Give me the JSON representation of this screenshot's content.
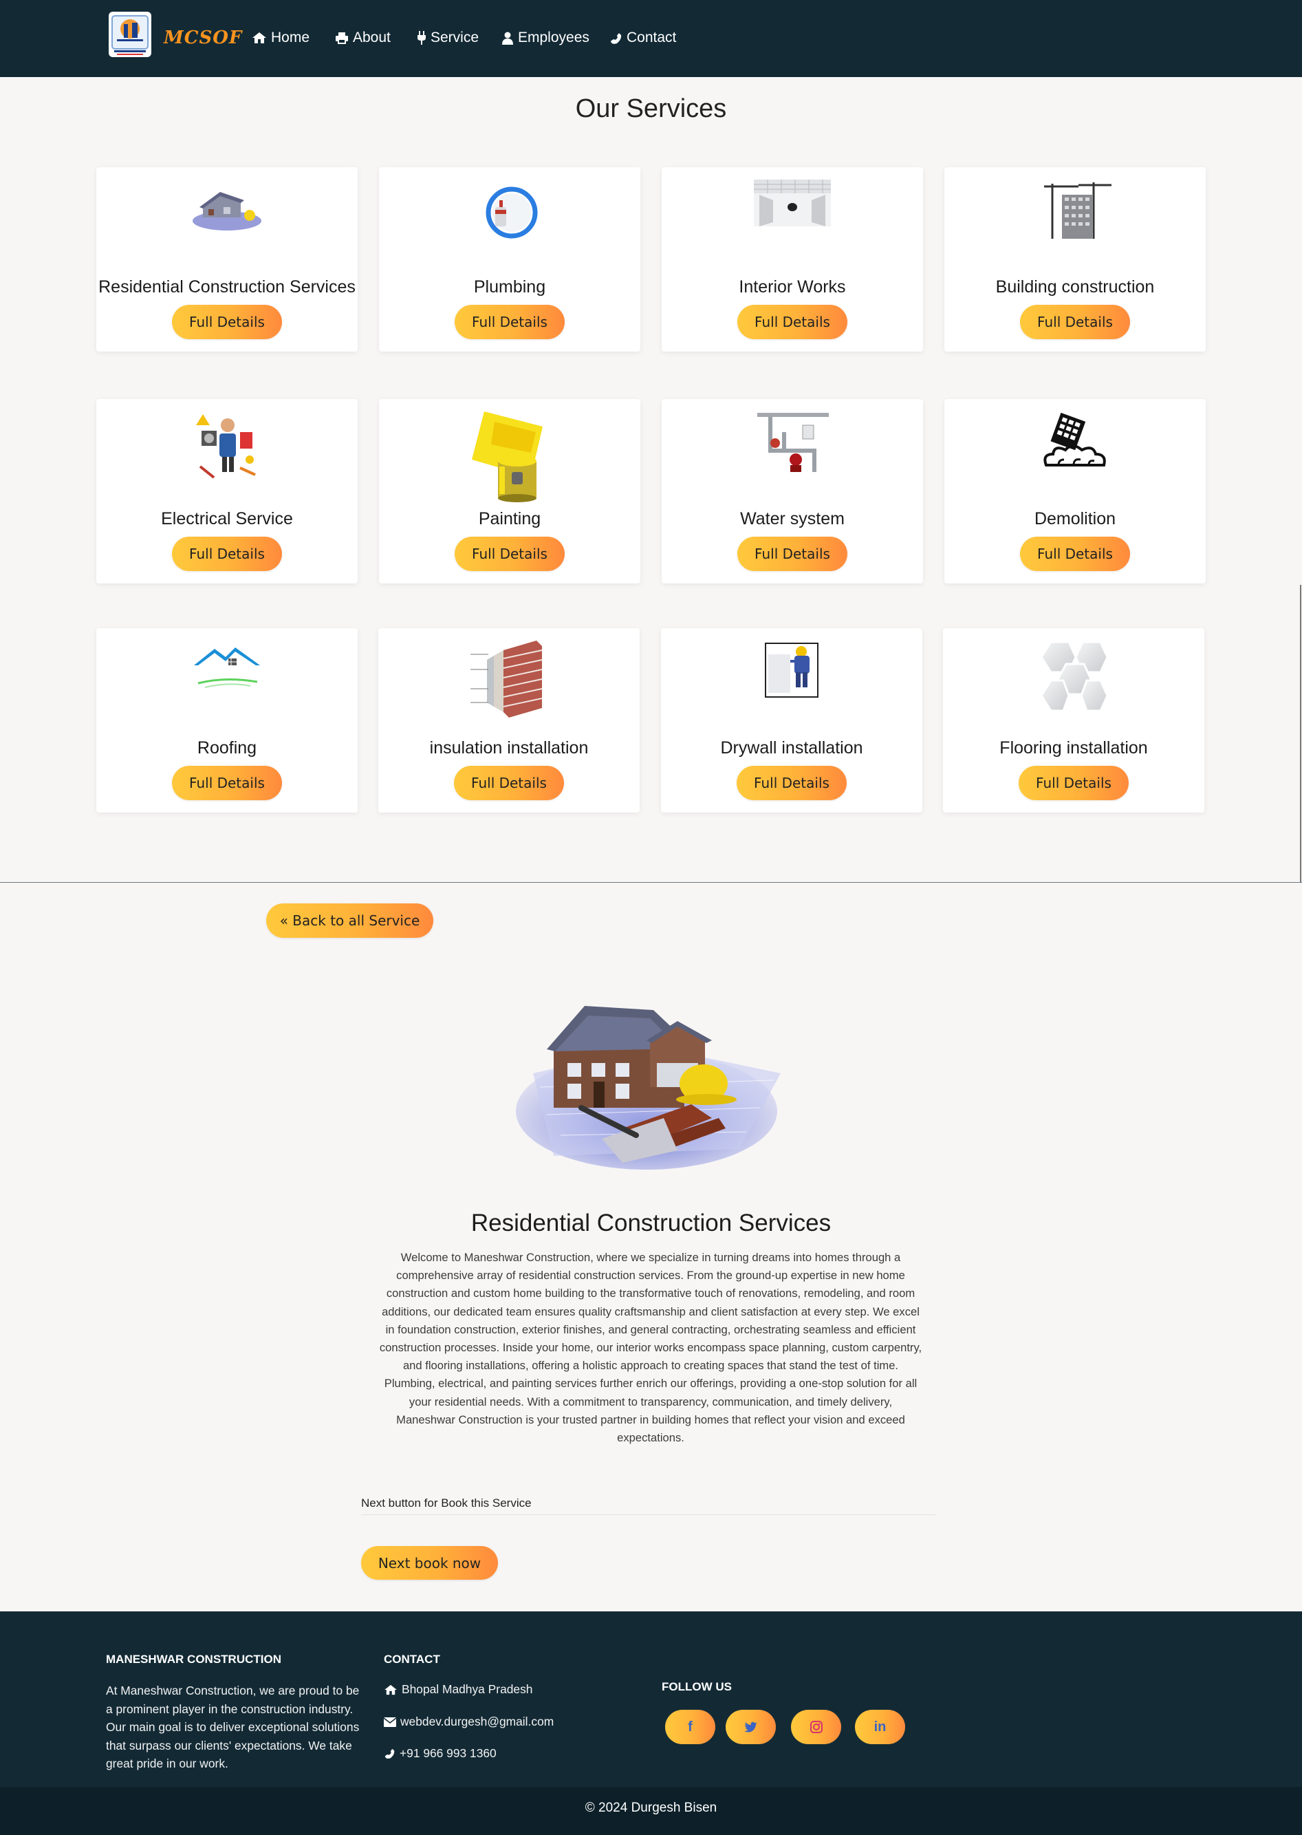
{
  "nav": {
    "brand": "MCSOF",
    "items": [
      "Home",
      "About",
      "Service",
      "Employees",
      "Contact"
    ]
  },
  "services": {
    "heading": "Our Services",
    "cards": [
      {
        "title": "Residential Construction Services",
        "button": "Full Details",
        "image": "house-blueprint"
      },
      {
        "title": "Plumbing",
        "button": "Full Details",
        "image": "pipe-faucet"
      },
      {
        "title": "Interior Works",
        "button": "Full Details",
        "image": "room-interior"
      },
      {
        "title": "Building construction",
        "button": "Full Details",
        "image": "building-crane"
      },
      {
        "title": "Electrical Service",
        "button": "Full Details",
        "image": "electrician-tools"
      },
      {
        "title": "Painting",
        "button": "Full Details",
        "image": "paint-roller"
      },
      {
        "title": "Water system",
        "button": "Full Details",
        "image": "water-pipes"
      },
      {
        "title": "Demolition",
        "button": "Full Details",
        "image": "demolition-building"
      },
      {
        "title": "Roofing",
        "button": "Full Details",
        "image": "roof"
      },
      {
        "title": "insulation installation",
        "button": "Full Details",
        "image": "brick-wall"
      },
      {
        "title": "Drywall installation",
        "button": "Full Details",
        "image": "drywall-worker"
      },
      {
        "title": "Flooring installation",
        "button": "Full Details",
        "image": "hex-tiles"
      }
    ]
  },
  "detail": {
    "back_button": "« Back to all Service",
    "title": "Residential Construction Services",
    "description": "Welcome to Maneshwar Construction, where we specialize in turning dreams into homes through a comprehensive array of residential construction services. From the ground-up expertise in new home construction and custom home building to the transformative touch of renovations, remodeling, and room additions, our dedicated team ensures quality craftsmanship and client satisfaction at every step. We excel in foundation construction, exterior finishes, and general contracting, orchestrating seamless and efficient construction processes. Inside your home, our interior works encompass space planning, custom carpentry, and flooring installations, offering a holistic approach to creating spaces that stand the test of time. Plumbing, electrical, and painting services further enrich our offerings, providing a one-stop solution for all your residential needs. With a commitment to transparency, communication, and timely delivery, Maneshwar Construction is your trusted partner in building homes that reflect your vision and exceed expectations.",
    "next_label": "Next button for Book this Service",
    "next_button": "Next book now"
  },
  "footer": {
    "about_heading": "MANESHWAR CONSTRUCTION",
    "about_text": "At Maneshwar Construction, we are proud to be a prominent player in the construction industry. Our main goal is to deliver exceptional solutions that surpass our clients' expectations. We take great pride in our work.",
    "contact_heading": "CONTACT",
    "address": "Bhopal Madhya Pradesh",
    "email": "webdev.durgesh@gmail.com",
    "phone": "+91 966 993 1360",
    "follow_heading": "FOLLOW US",
    "social": [
      "f",
      "t",
      "ig",
      "in"
    ],
    "copyright": "© 2024 Durgesh Bisen"
  },
  "colors": {
    "navbar": "#132a35",
    "button_start": "#ffc93c",
    "button_end": "#ff8a3c",
    "brand": "#f7931e"
  }
}
